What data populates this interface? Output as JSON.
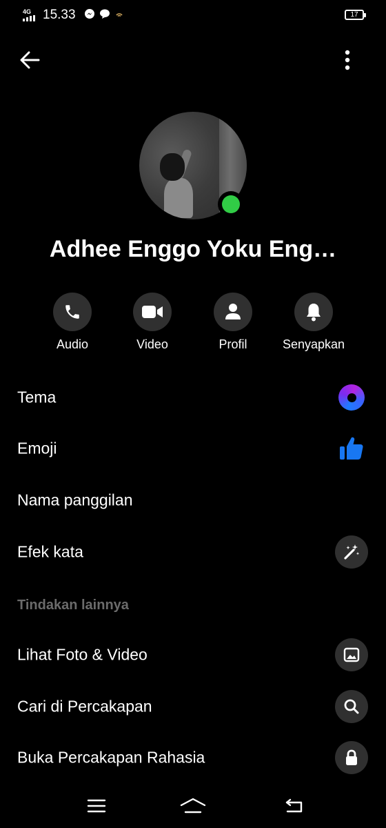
{
  "status_bar": {
    "network": "4G",
    "time": "15.33",
    "notification_icons": [
      "messenger-icon",
      "chat-bubble-icon",
      "wifi-hotspot-icon"
    ],
    "battery": "17"
  },
  "profile": {
    "name": "Adhee Enggo Yoku Eng…",
    "online": true,
    "online_color": "#31cc46"
  },
  "actions": [
    {
      "label": "Audio",
      "icon": "phone-icon"
    },
    {
      "label": "Video",
      "icon": "video-camera-icon"
    },
    {
      "label": "Profil",
      "icon": "person-icon"
    },
    {
      "label": "Senyapkan",
      "icon": "bell-icon"
    }
  ],
  "customize_items": [
    {
      "label": "Tema",
      "icon": "theme-icon"
    },
    {
      "label": "Emoji",
      "icon": "thumbs-up-icon",
      "icon_color": "#1877f2"
    },
    {
      "label": "Nama panggilan"
    },
    {
      "label": "Efek kata",
      "icon": "magic-wand-icon"
    }
  ],
  "more_actions": {
    "header": "Tindakan lainnya",
    "items": [
      {
        "label": "Lihat Foto & Video",
        "icon": "image-icon"
      },
      {
        "label": "Cari di Percakapan",
        "icon": "search-icon"
      },
      {
        "label": "Buka Percakapan Rahasia",
        "icon": "lock-icon"
      }
    ]
  },
  "nav_bar": [
    "menu-icon",
    "home-icon",
    "back-icon"
  ],
  "colors": {
    "background": "#000000",
    "button_circle": "#303030",
    "section_header": "#6b6b6b"
  }
}
